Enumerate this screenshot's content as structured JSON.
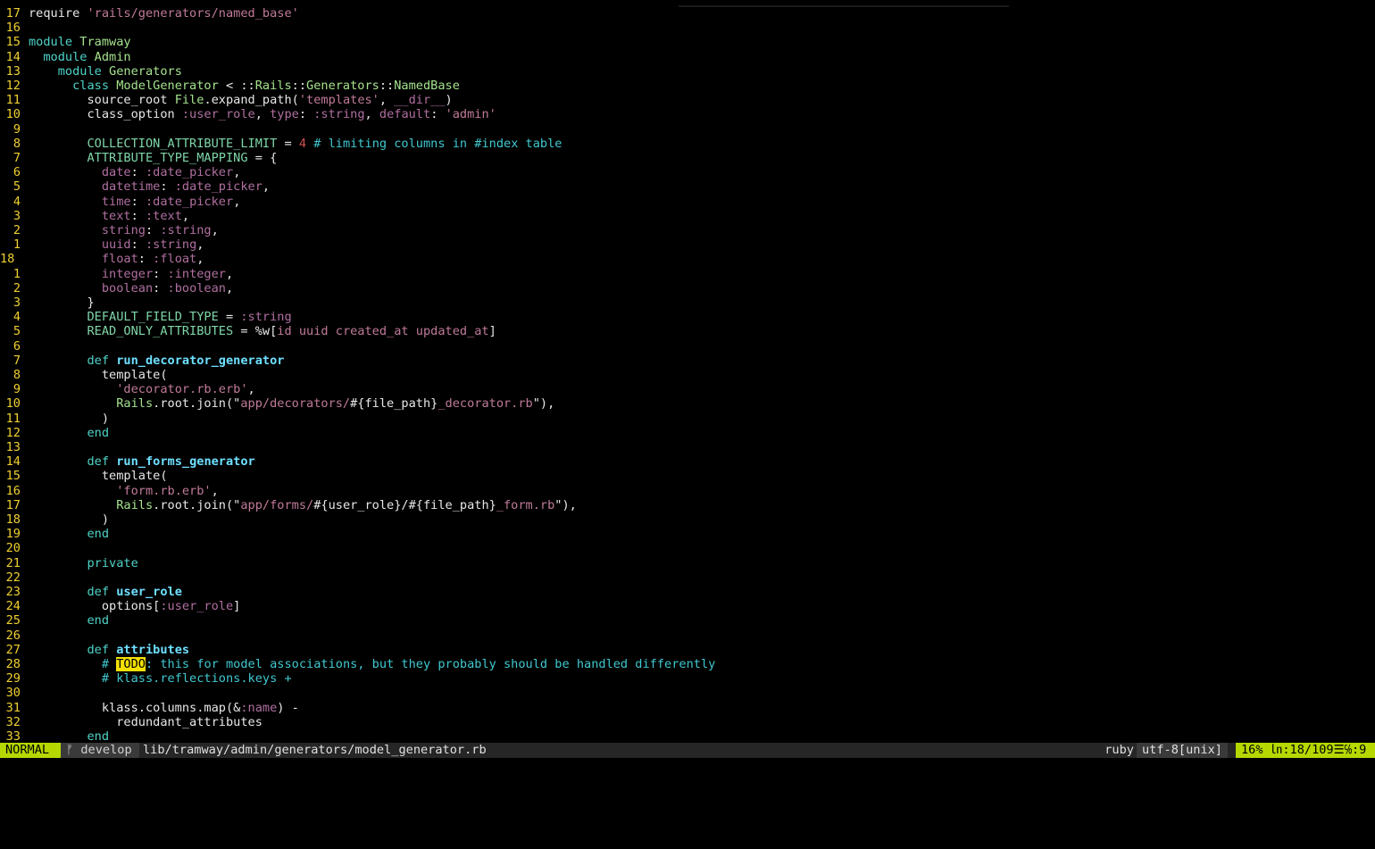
{
  "editor": {
    "lines": [
      {
        "n": "17",
        "cur": false,
        "toks": [
          [
            "plain",
            "require "
          ],
          [
            "str",
            "'rails/generators/named_base'"
          ]
        ]
      },
      {
        "n": "16",
        "cur": false,
        "toks": []
      },
      {
        "n": "15",
        "cur": false,
        "toks": [
          [
            "kw",
            "module "
          ],
          [
            "cls",
            "Tramway"
          ]
        ]
      },
      {
        "n": "14",
        "cur": false,
        "toks": [
          [
            "plain",
            "  "
          ],
          [
            "kw",
            "module "
          ],
          [
            "cls",
            "Admin"
          ]
        ]
      },
      {
        "n": "13",
        "cur": false,
        "toks": [
          [
            "plain",
            "    "
          ],
          [
            "kw",
            "module "
          ],
          [
            "cls",
            "Generators"
          ]
        ]
      },
      {
        "n": "12",
        "cur": false,
        "toks": [
          [
            "plain",
            "      "
          ],
          [
            "kw",
            "class "
          ],
          [
            "cls",
            "ModelGenerator"
          ],
          [
            "plain",
            " < ::"
          ],
          [
            "cls",
            "Rails"
          ],
          [
            "plain",
            "::"
          ],
          [
            "cls",
            "Generators"
          ],
          [
            "plain",
            "::"
          ],
          [
            "cls",
            "NamedBase"
          ]
        ]
      },
      {
        "n": "11",
        "cur": false,
        "toks": [
          [
            "plain",
            "        source_root "
          ],
          [
            "cls",
            "File"
          ],
          [
            "plain",
            ".expand_path("
          ],
          [
            "str",
            "'templates'"
          ],
          [
            "plain",
            ", "
          ],
          [
            "sym",
            "__dir__"
          ],
          [
            "plain",
            ")"
          ]
        ]
      },
      {
        "n": "10",
        "cur": false,
        "toks": [
          [
            "plain",
            "        class_option "
          ],
          [
            "sym",
            ":user_role"
          ],
          [
            "plain",
            ", "
          ],
          [
            "sym",
            "type"
          ],
          [
            "plain",
            ": "
          ],
          [
            "sym",
            ":string"
          ],
          [
            "plain",
            ", "
          ],
          [
            "sym",
            "default"
          ],
          [
            "plain",
            ": "
          ],
          [
            "str",
            "'admin'"
          ]
        ]
      },
      {
        "n": "9",
        "cur": false,
        "toks": []
      },
      {
        "n": "8",
        "cur": false,
        "toks": [
          [
            "plain",
            "        "
          ],
          [
            "const",
            "COLLECTION_ATTRIBUTE_LIMIT"
          ],
          [
            "plain",
            " = "
          ],
          [
            "num",
            "4"
          ],
          [
            "plain",
            " "
          ],
          [
            "cmt",
            "# limiting columns in #index table"
          ]
        ]
      },
      {
        "n": "7",
        "cur": false,
        "toks": [
          [
            "plain",
            "        "
          ],
          [
            "const",
            "ATTRIBUTE_TYPE_MAPPING"
          ],
          [
            "plain",
            " = {"
          ]
        ]
      },
      {
        "n": "6",
        "cur": false,
        "toks": [
          [
            "plain",
            "          "
          ],
          [
            "sym",
            "date"
          ],
          [
            "plain",
            ": "
          ],
          [
            "sym",
            ":date_picker"
          ],
          [
            "plain",
            ","
          ]
        ]
      },
      {
        "n": "5",
        "cur": false,
        "toks": [
          [
            "plain",
            "          "
          ],
          [
            "sym",
            "datetime"
          ],
          [
            "plain",
            ": "
          ],
          [
            "sym",
            ":date_picker"
          ],
          [
            "plain",
            ","
          ]
        ]
      },
      {
        "n": "4",
        "cur": false,
        "toks": [
          [
            "plain",
            "          "
          ],
          [
            "sym",
            "time"
          ],
          [
            "plain",
            ": "
          ],
          [
            "sym",
            ":date_picker"
          ],
          [
            "plain",
            ","
          ]
        ]
      },
      {
        "n": "3",
        "cur": false,
        "toks": [
          [
            "plain",
            "          "
          ],
          [
            "sym",
            "text"
          ],
          [
            "plain",
            ": "
          ],
          [
            "sym",
            ":text"
          ],
          [
            "plain",
            ","
          ]
        ]
      },
      {
        "n": "2",
        "cur": false,
        "toks": [
          [
            "plain",
            "          "
          ],
          [
            "sym",
            "string"
          ],
          [
            "plain",
            ": "
          ],
          [
            "sym",
            ":string"
          ],
          [
            "plain",
            ","
          ]
        ]
      },
      {
        "n": "1",
        "cur": false,
        "toks": [
          [
            "plain",
            "          "
          ],
          [
            "sym",
            "uuid"
          ],
          [
            "plain",
            ": "
          ],
          [
            "sym",
            ":string"
          ],
          [
            "plain",
            ","
          ]
        ]
      },
      {
        "n": "18",
        "cur": true,
        "toks": [
          [
            "plain",
            "          "
          ],
          [
            "sym",
            "float"
          ],
          [
            "plain",
            ": "
          ],
          [
            "sym",
            ":float"
          ],
          [
            "plain",
            ","
          ]
        ]
      },
      {
        "n": "1",
        "cur": false,
        "toks": [
          [
            "plain",
            "          "
          ],
          [
            "sym",
            "integer"
          ],
          [
            "plain",
            ": "
          ],
          [
            "sym",
            ":integer"
          ],
          [
            "plain",
            ","
          ]
        ]
      },
      {
        "n": "2",
        "cur": false,
        "toks": [
          [
            "plain",
            "          "
          ],
          [
            "sym",
            "boolean"
          ],
          [
            "plain",
            ": "
          ],
          [
            "sym",
            ":boolean"
          ],
          [
            "plain",
            ","
          ]
        ]
      },
      {
        "n": "3",
        "cur": false,
        "toks": [
          [
            "plain",
            "        }"
          ]
        ]
      },
      {
        "n": "4",
        "cur": false,
        "toks": [
          [
            "plain",
            "        "
          ],
          [
            "const",
            "DEFAULT_FIELD_TYPE"
          ],
          [
            "plain",
            " = "
          ],
          [
            "sym",
            ":string"
          ]
        ]
      },
      {
        "n": "5",
        "cur": false,
        "toks": [
          [
            "plain",
            "        "
          ],
          [
            "const",
            "READ_ONLY_ATTRIBUTES"
          ],
          [
            "plain",
            " = %w["
          ],
          [
            "str",
            "id uuid created_at updated_at"
          ],
          [
            "plain",
            "]"
          ]
        ]
      },
      {
        "n": "6",
        "cur": false,
        "toks": []
      },
      {
        "n": "7",
        "cur": false,
        "toks": [
          [
            "plain",
            "        "
          ],
          [
            "kw",
            "def "
          ],
          [
            "fn",
            "run_decorator_generator"
          ]
        ]
      },
      {
        "n": "8",
        "cur": false,
        "toks": [
          [
            "plain",
            "          template("
          ]
        ]
      },
      {
        "n": "9",
        "cur": false,
        "toks": [
          [
            "plain",
            "            "
          ],
          [
            "str",
            "'decorator.rb.erb'"
          ],
          [
            "plain",
            ","
          ]
        ]
      },
      {
        "n": "10",
        "cur": false,
        "toks": [
          [
            "plain",
            "            "
          ],
          [
            "cls",
            "Rails"
          ],
          [
            "plain",
            ".root.join(\""
          ],
          [
            "str",
            "app/decorators/"
          ],
          [
            "plain",
            "#{file_path}"
          ],
          [
            "str",
            "_decorator.rb"
          ],
          [
            "plain",
            "\"),"
          ]
        ]
      },
      {
        "n": "11",
        "cur": false,
        "toks": [
          [
            "plain",
            "          )"
          ]
        ]
      },
      {
        "n": "12",
        "cur": false,
        "toks": [
          [
            "plain",
            "        "
          ],
          [
            "kw",
            "end"
          ]
        ]
      },
      {
        "n": "13",
        "cur": false,
        "toks": []
      },
      {
        "n": "14",
        "cur": false,
        "toks": [
          [
            "plain",
            "        "
          ],
          [
            "kw",
            "def "
          ],
          [
            "fn",
            "run_forms_generator"
          ]
        ]
      },
      {
        "n": "15",
        "cur": false,
        "toks": [
          [
            "plain",
            "          template("
          ]
        ]
      },
      {
        "n": "16",
        "cur": false,
        "toks": [
          [
            "plain",
            "            "
          ],
          [
            "str",
            "'form.rb.erb'"
          ],
          [
            "plain",
            ","
          ]
        ]
      },
      {
        "n": "17",
        "cur": false,
        "toks": [
          [
            "plain",
            "            "
          ],
          [
            "cls",
            "Rails"
          ],
          [
            "plain",
            ".root.join(\""
          ],
          [
            "str",
            "app/forms/"
          ],
          [
            "plain",
            "#{user_role}/#{file_path}"
          ],
          [
            "str",
            "_form.rb"
          ],
          [
            "plain",
            "\"),"
          ]
        ]
      },
      {
        "n": "18",
        "cur": false,
        "toks": [
          [
            "plain",
            "          )"
          ]
        ]
      },
      {
        "n": "19",
        "cur": false,
        "toks": [
          [
            "plain",
            "        "
          ],
          [
            "kw",
            "end"
          ]
        ]
      },
      {
        "n": "20",
        "cur": false,
        "toks": []
      },
      {
        "n": "21",
        "cur": false,
        "toks": [
          [
            "plain",
            "        "
          ],
          [
            "kw",
            "private"
          ]
        ]
      },
      {
        "n": "22",
        "cur": false,
        "toks": []
      },
      {
        "n": "23",
        "cur": false,
        "toks": [
          [
            "plain",
            "        "
          ],
          [
            "kw",
            "def "
          ],
          [
            "fn",
            "user_role"
          ]
        ]
      },
      {
        "n": "24",
        "cur": false,
        "toks": [
          [
            "plain",
            "          options["
          ],
          [
            "sym",
            ":user_role"
          ],
          [
            "plain",
            "]"
          ]
        ]
      },
      {
        "n": "25",
        "cur": false,
        "toks": [
          [
            "plain",
            "        "
          ],
          [
            "kw",
            "end"
          ]
        ]
      },
      {
        "n": "26",
        "cur": false,
        "toks": []
      },
      {
        "n": "27",
        "cur": false,
        "toks": [
          [
            "plain",
            "        "
          ],
          [
            "kw",
            "def "
          ],
          [
            "fn",
            "attributes"
          ]
        ]
      },
      {
        "n": "28",
        "cur": false,
        "toks": [
          [
            "plain",
            "          "
          ],
          [
            "cmt",
            "# "
          ],
          [
            "todo",
            "TODO"
          ],
          [
            "cmt",
            ": this for model associations, but they probably should be handled differently"
          ]
        ]
      },
      {
        "n": "29",
        "cur": false,
        "toks": [
          [
            "plain",
            "          "
          ],
          [
            "cmt",
            "# klass.reflections.keys +"
          ]
        ]
      },
      {
        "n": "30",
        "cur": false,
        "toks": []
      },
      {
        "n": "31",
        "cur": false,
        "toks": [
          [
            "plain",
            "          klass.columns.map(&"
          ],
          [
            "sym",
            ":name"
          ],
          [
            "plain",
            ") -"
          ]
        ]
      },
      {
        "n": "32",
        "cur": false,
        "toks": [
          [
            "plain",
            "            redundant_attributes"
          ]
        ]
      },
      {
        "n": "33",
        "cur": false,
        "toks": [
          [
            "plain",
            "        "
          ],
          [
            "kw",
            "end"
          ]
        ]
      }
    ]
  },
  "status": {
    "mode": "NORMAL",
    "branch": "ᚠ develop",
    "filepath": "lib/tramway/admin/generators/model_generator.rb",
    "filetype": "ruby",
    "encoding": "utf-8[unix]",
    "position": "16% ㏑:18/109☰℅:9"
  }
}
